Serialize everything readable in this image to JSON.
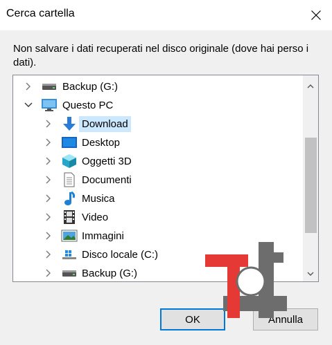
{
  "window": {
    "title": "Cerca cartella"
  },
  "instruction": "Non salvare i dati recuperati nel disco originale (dove hai perso i dati).",
  "tree": {
    "items": [
      {
        "label": "Backup (G:)",
        "icon": "drive-icon",
        "expanded": false,
        "selected": false
      },
      {
        "label": "Questo PC",
        "icon": "pc-icon",
        "expanded": true,
        "selected": false
      },
      {
        "label": "Download",
        "icon": "download-arrow-icon",
        "expanded": false,
        "selected": true
      },
      {
        "label": "Desktop",
        "icon": "desktop-icon",
        "expanded": false,
        "selected": false
      },
      {
        "label": "Oggetti 3D",
        "icon": "cube-3d-icon",
        "expanded": false,
        "selected": false
      },
      {
        "label": "Documenti",
        "icon": "document-icon",
        "expanded": false,
        "selected": false
      },
      {
        "label": "Musica",
        "icon": "music-note-icon",
        "expanded": false,
        "selected": false
      },
      {
        "label": "Video",
        "icon": "film-icon",
        "expanded": false,
        "selected": false
      },
      {
        "label": "Immagini",
        "icon": "picture-icon",
        "expanded": false,
        "selected": false
      },
      {
        "label": "Disco locale (C:)",
        "icon": "windows-drive-icon",
        "expanded": false,
        "selected": false
      },
      {
        "label": "Backup (G:)",
        "icon": "drive-icon",
        "expanded": false,
        "selected": false
      }
    ]
  },
  "buttons": {
    "ok": "OK",
    "cancel": "Annulla"
  },
  "colors": {
    "selection": "#cce8ff",
    "focus": "#0078d7",
    "watermark_red": "#e53935",
    "watermark_gray": "#6d6d6d"
  }
}
